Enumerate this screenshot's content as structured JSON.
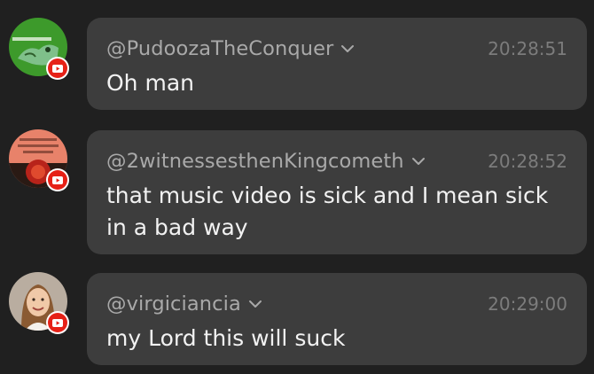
{
  "colors": {
    "background": "#202020",
    "bubble": "#3d3d3d",
    "author": "#a9a9a9",
    "timestamp": "#7c7c7c",
    "message_text": "#f2f2f2",
    "youtube_red": "#e62117"
  },
  "messages": [
    {
      "author": "@PudoozaTheConquer",
      "time": "20:28:51",
      "text": "Oh man",
      "platform_icon": "youtube-icon"
    },
    {
      "author": "@2witnessesthenKingcometh",
      "time": "20:28:52",
      "text": "that music video is sick and I mean sick in a bad way",
      "platform_icon": "youtube-icon"
    },
    {
      "author": "@virgiciancia",
      "time": "20:29:00",
      "text": "my Lord this will suck",
      "platform_icon": "youtube-icon"
    }
  ]
}
